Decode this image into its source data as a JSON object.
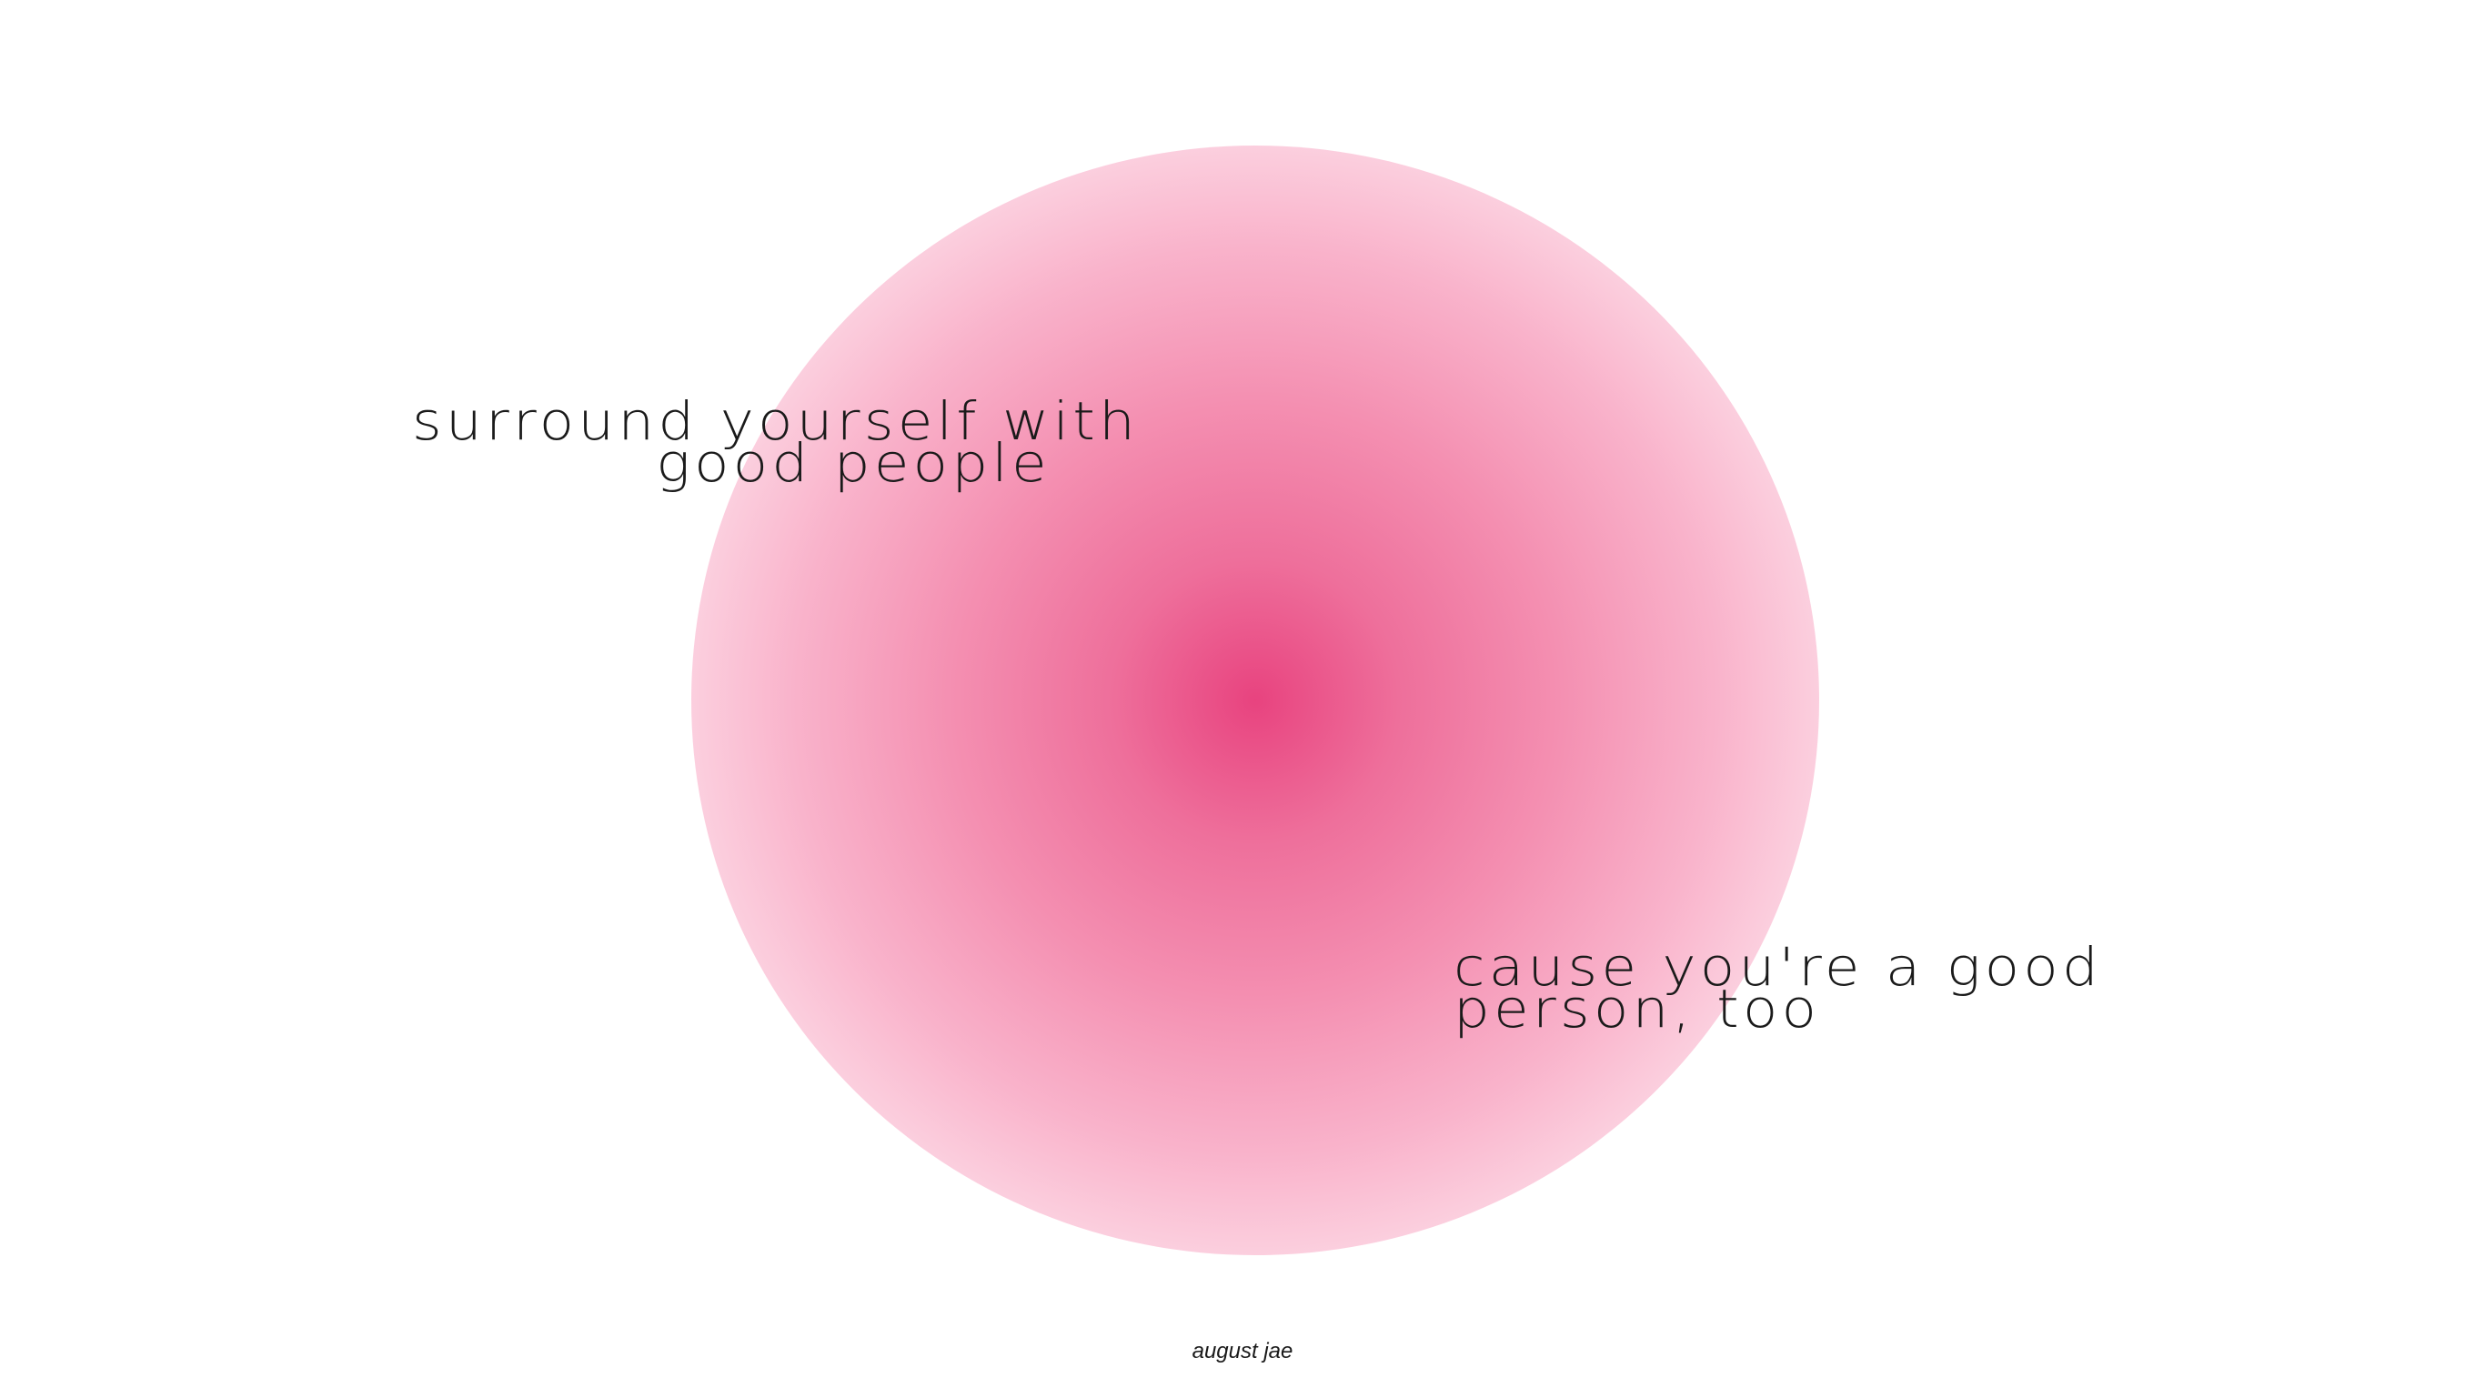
{
  "quote": {
    "line1": "surround yourself with",
    "line2": "good people",
    "line3": "cause you're a good",
    "line4": "person, too"
  },
  "author": "august jae",
  "colors": {
    "background": "#ffffff",
    "glow_center": "#e8437f",
    "glow_edge": "#fcd6e3",
    "text": "#1a1a1a"
  }
}
